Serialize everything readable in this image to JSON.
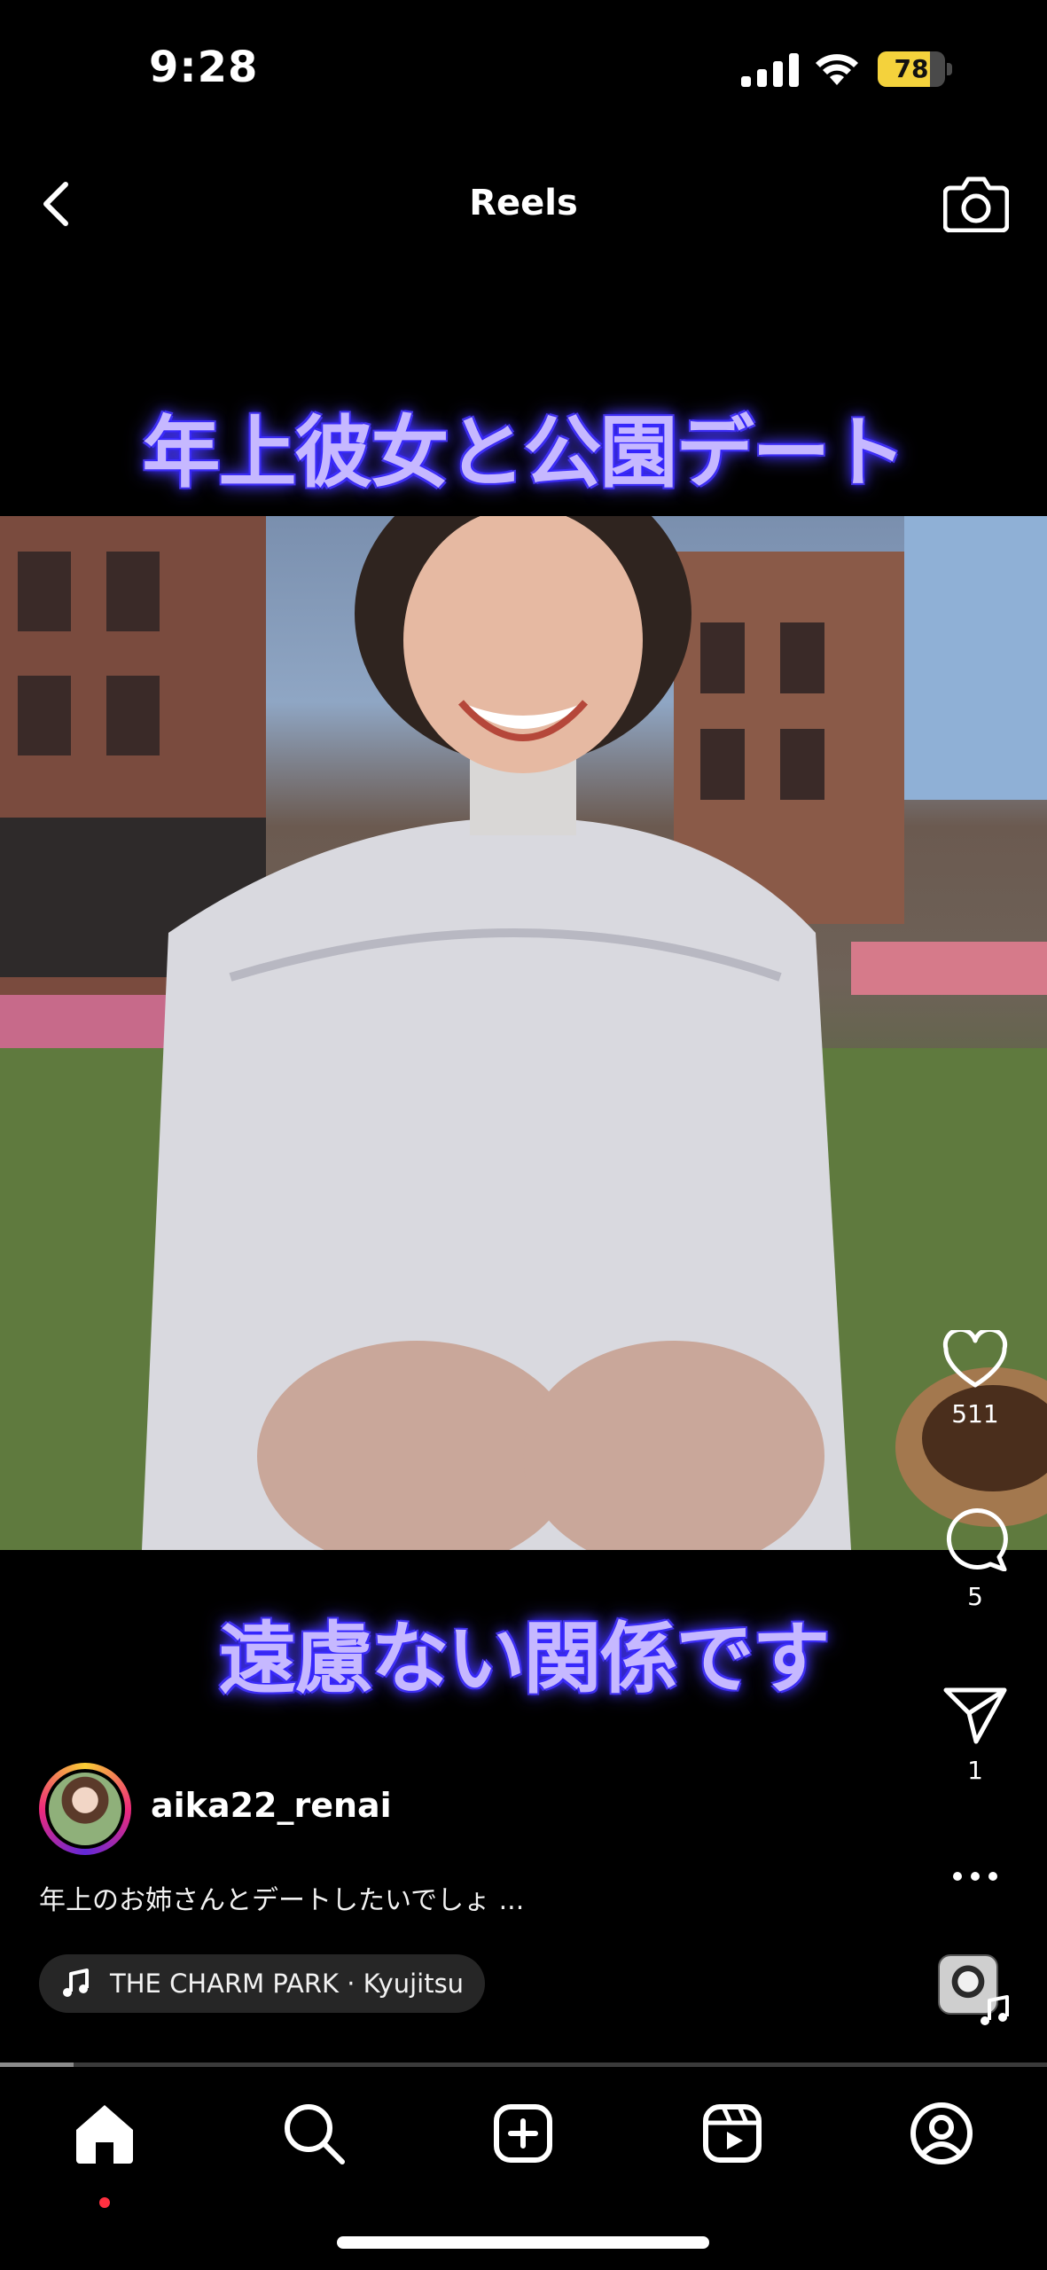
{
  "status_bar": {
    "time": "9:28",
    "battery_level": "78",
    "battery_fraction": 0.78,
    "battery_color": "#f4d23c",
    "signal_icon": "cellular-signal-icon",
    "wifi_icon": "wifi-icon"
  },
  "header": {
    "title": "Reels",
    "back_icon": "chevron-left-icon",
    "camera_icon": "camera-icon"
  },
  "reel": {
    "caption_top": "年上彼女と公園デート",
    "caption_bottom": "遠慮ない関係です",
    "caption_color": "#c6b8ff",
    "caption_glow": "#3a2bff"
  },
  "actions": {
    "like_count": "511",
    "comment_count": "5",
    "share_count": "1",
    "like_icon": "heart-icon",
    "comment_icon": "comment-bubble-icon",
    "share_icon": "send-icon",
    "more_icon": "more-horizontal-icon"
  },
  "author": {
    "username": "aika22_renai"
  },
  "description": "年上のお姉さんとデートしたいでしょ ...",
  "music": {
    "label": "THE CHARM PARK · Kyujitsu",
    "icon": "music-note-icon"
  },
  "playback": {
    "progress_fraction": 0.07
  },
  "tab_bar": {
    "items": [
      "home-icon",
      "search-icon",
      "create-icon",
      "reels-icon",
      "profile-icon"
    ],
    "active": "home-icon",
    "notification_color": "#ff3040"
  }
}
